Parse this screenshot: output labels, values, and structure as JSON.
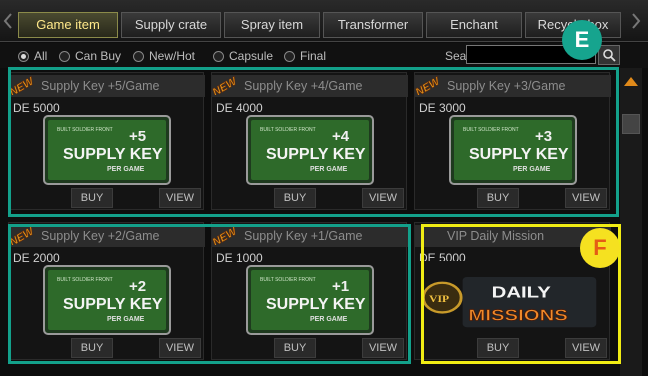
{
  "tabs": [
    {
      "label": "Game item",
      "active": true
    },
    {
      "label": "Supply crate",
      "active": false
    },
    {
      "label": "Spray item",
      "active": false
    },
    {
      "label": "Transformer",
      "active": false
    },
    {
      "label": "Enchant",
      "active": false
    },
    {
      "label": "Recycle box",
      "active": false
    }
  ],
  "filters": [
    {
      "label": "All",
      "checked": true
    },
    {
      "label": "Can Buy",
      "checked": false
    },
    {
      "label": "New/Hot",
      "checked": false
    },
    {
      "label": "Capsule",
      "checked": false
    },
    {
      "label": "Final",
      "checked": false
    }
  ],
  "search": {
    "label": "Search",
    "value": ""
  },
  "badges": {
    "e": "E",
    "f": "F"
  },
  "items": [
    {
      "title": "Supply Key +5/Game",
      "price": "DE 5000",
      "new": true,
      "img_top": "BUILT SOLDIER FRONT",
      "img_main": "SUPPLY KEY",
      "img_sub": "PER GAME",
      "img_plus": "+5",
      "buy": "BUY",
      "view": "VIEW"
    },
    {
      "title": "Supply Key +4/Game",
      "price": "DE 4000",
      "new": true,
      "img_top": "BUILT SOLDIER FRONT",
      "img_main": "SUPPLY KEY",
      "img_sub": "PER GAME",
      "img_plus": "+4",
      "buy": "BUY",
      "view": "VIEW"
    },
    {
      "title": "Supply Key +3/Game",
      "price": "DE 3000",
      "new": true,
      "img_top": "BUILT SOLDIER FRONT",
      "img_main": "SUPPLY KEY",
      "img_sub": "PER GAME",
      "img_plus": "+3",
      "buy": "BUY",
      "view": "VIEW"
    },
    {
      "title": "Supply Key +2/Game",
      "price": "DE 2000",
      "new": true,
      "img_top": "BUILT SOLDIER FRONT",
      "img_main": "SUPPLY KEY",
      "img_sub": "PER GAME",
      "img_plus": "+2",
      "buy": "BUY",
      "view": "VIEW"
    },
    {
      "title": "Supply Key +1/Game",
      "price": "DE 1000",
      "new": true,
      "img_top": "BUILT SOLDIER FRONT",
      "img_main": "SUPPLY KEY",
      "img_sub": "PER GAME",
      "img_plus": "+1",
      "buy": "BUY",
      "view": "VIEW"
    },
    {
      "title": "VIP Daily Mission",
      "price": "DE 5000",
      "new": false,
      "img_vip": "VIP",
      "img_line1": "DAILY",
      "img_line2": "MISSIONS",
      "buy": "BUY",
      "view": "VIEW"
    }
  ],
  "new_label": "NEW",
  "colors": {
    "teal": "#13a08a",
    "yellow": "#f0ec14",
    "active_tab": "#ffe88a"
  }
}
